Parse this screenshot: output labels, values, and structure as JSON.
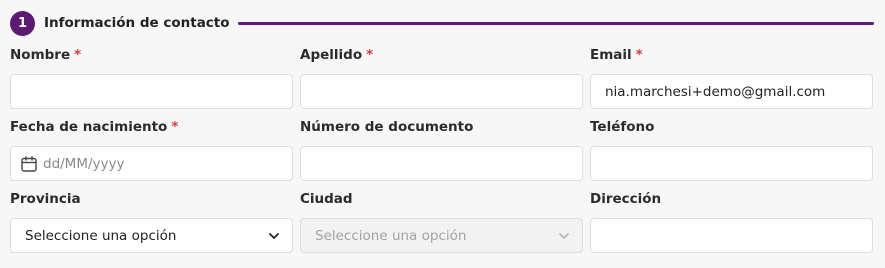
{
  "section": {
    "step_number": "1",
    "title": "Información de contacto"
  },
  "colors": {
    "accent": "#5b1a73",
    "required": "#d63b3b"
  },
  "required_mark": "*",
  "fields": {
    "nombre": {
      "label": "Nombre",
      "value": ""
    },
    "apellido": {
      "label": "Apellido",
      "value": ""
    },
    "email": {
      "label": "Email",
      "value": "nia.marchesi+demo@gmail.com"
    },
    "fecha_nacimiento": {
      "label": "Fecha de nacimiento",
      "placeholder": "dd/MM/yyyy",
      "icon": "calendar-icon"
    },
    "numero_documento": {
      "label": "Número de documento",
      "value": ""
    },
    "telefono": {
      "label": "Teléfono",
      "value": ""
    },
    "provincia": {
      "label": "Provincia",
      "selected": "Seleccione una opción",
      "icon": "chevron-down-icon"
    },
    "ciudad": {
      "label": "Ciudad",
      "selected": "Seleccione una opción",
      "disabled": true,
      "icon": "chevron-down-icon"
    },
    "direccion": {
      "label": "Dirección",
      "value": ""
    }
  }
}
